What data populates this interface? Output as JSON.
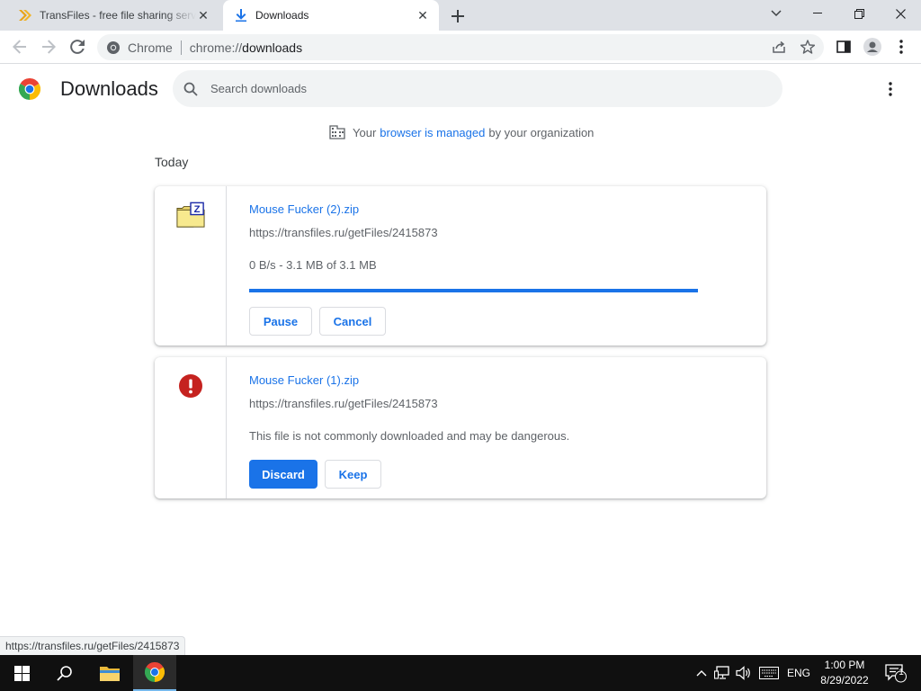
{
  "browser": {
    "tabs": [
      {
        "title": "TransFiles - free file sharing service",
        "icon": "transfiles-icon"
      },
      {
        "title": "Downloads",
        "icon": "download-icon"
      }
    ],
    "omnibox": {
      "site_chip": "Chrome",
      "url_scheme": "chrome://",
      "url_path": "downloads"
    }
  },
  "page": {
    "title": "Downloads",
    "search_placeholder": "Search downloads",
    "managed": {
      "prefix": "Your",
      "link": "browser is managed",
      "suffix": "by your organization"
    },
    "section": "Today"
  },
  "downloads": [
    {
      "name": "Mouse Fucker (2).zip",
      "url": "https://transfiles.ru/getFiles/2415873",
      "status": "0 B/s - 3.1 MB of 3.1 MB",
      "progress": 1.0,
      "icon": "zip-file-icon",
      "buttons": {
        "first": "Pause",
        "second": "Cancel"
      }
    },
    {
      "name": "Mouse Fucker (1).zip",
      "url": "https://transfiles.ru/getFiles/2415873",
      "status": "This file is not commonly downloaded and may be dangerous.",
      "icon": "warning-icon",
      "buttons": {
        "first": "Discard",
        "second": "Keep"
      }
    }
  ],
  "statusbar": {
    "url": "https://transfiles.ru/getFiles/2415873"
  },
  "taskbar": {
    "language": "ENG",
    "time": "1:00 PM",
    "date": "8/29/2022",
    "notification_count": "1"
  },
  "colors": {
    "accent": "#1a73e8",
    "danger": "#c5221f",
    "taskbar": "#101010"
  }
}
